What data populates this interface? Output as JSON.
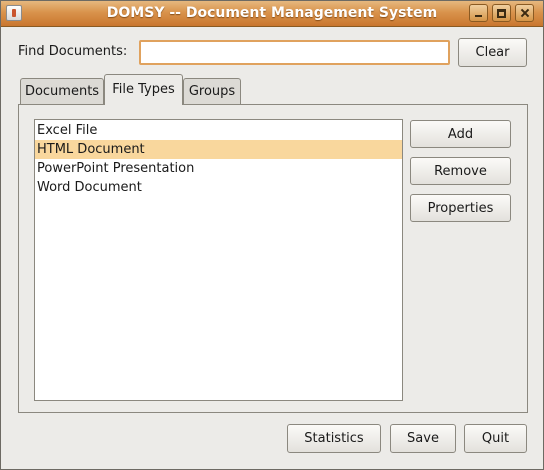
{
  "window": {
    "title": "DOMSY -- Document Management System"
  },
  "find": {
    "label": "Find Documents:",
    "value": "",
    "placeholder": "",
    "clear_label": "Clear"
  },
  "tabs": [
    {
      "label": "Documents",
      "selected": false
    },
    {
      "label": "File Types",
      "selected": true
    },
    {
      "label": "Groups",
      "selected": false
    }
  ],
  "file_types": {
    "items": [
      {
        "label": "Excel File",
        "selected": false
      },
      {
        "label": "HTML Document",
        "selected": true
      },
      {
        "label": "PowerPoint Presentation",
        "selected": false
      },
      {
        "label": "Word Document",
        "selected": false
      }
    ],
    "add_label": "Add",
    "remove_label": "Remove",
    "properties_label": "Properties"
  },
  "footer": {
    "statistics_label": "Statistics",
    "save_label": "Save",
    "quit_label": "Quit"
  },
  "colors": {
    "title_bar": "#d9934c",
    "selection": "#f9d79d",
    "focus_border": "#e0a25e",
    "window_bg": "#ecebe8"
  },
  "icons": [
    "app-icon",
    "minimize-icon",
    "maximize-icon",
    "close-icon"
  ]
}
